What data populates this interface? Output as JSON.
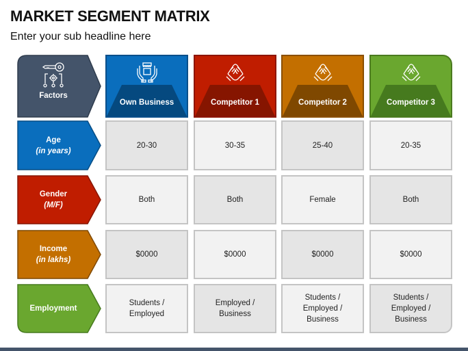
{
  "title": "MARKET SEGMENT MATRIX",
  "subtitle": "Enter your sub headline here",
  "colors": {
    "factors": "#44546a",
    "own_business": "#0a6ebd",
    "competitor_1": "#c01d00",
    "competitor_2": "#c36f00",
    "competitor_3": "#6aa72f",
    "cell_dark": "#e5e5e5",
    "cell_light": "#f2f2f2",
    "footer": "#44546a"
  },
  "corner": {
    "label": "Factors",
    "icon": "key-gear-network-icon"
  },
  "columns": [
    {
      "label": "Own Business",
      "icon": "hands-holding-shop-icon"
    },
    {
      "label": "Competitor 1",
      "icon": "handshake-icon"
    },
    {
      "label": "Competitor 2",
      "icon": "handshake-icon"
    },
    {
      "label": "Competitor 3",
      "icon": "handshake-icon"
    }
  ],
  "rows": [
    {
      "label": "Age",
      "sub": "(in years)",
      "values": [
        "20-30",
        "30-35",
        "25-40",
        "20-35"
      ]
    },
    {
      "label": "Gender",
      "sub": "(M/F)",
      "values": [
        "Both",
        "Both",
        "Female",
        "Both"
      ]
    },
    {
      "label": "Income",
      "sub": "(in lakhs)",
      "values": [
        "$0000",
        "$0000",
        "$0000",
        "$0000"
      ]
    },
    {
      "label": "Employment",
      "sub": "",
      "values": [
        "Students / Employed",
        "Employed / Business",
        "Students / Employed / Business",
        "Students / Employed / Business"
      ]
    }
  ]
}
